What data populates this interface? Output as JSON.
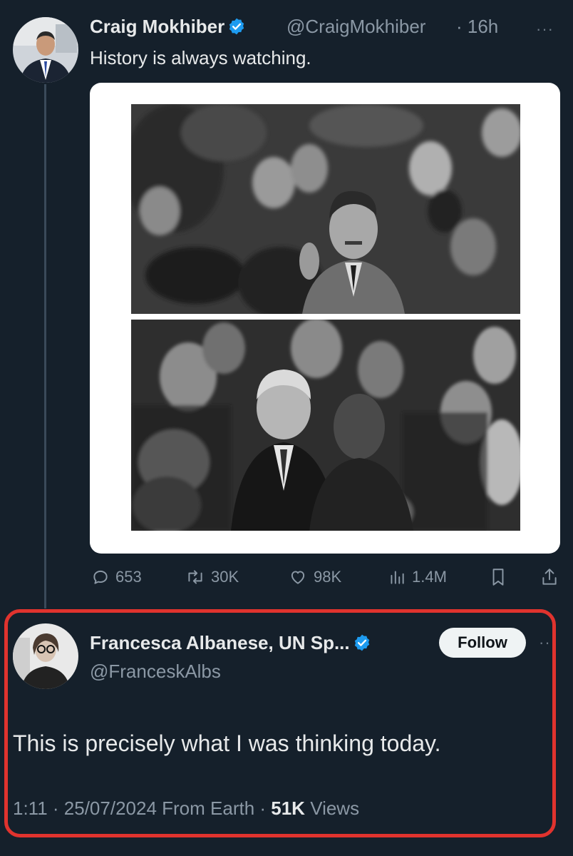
{
  "tweet1": {
    "name": "Craig Mokhiber",
    "handle": "@CraigMokhiber",
    "time": "· 16h",
    "text": "History is always watching.",
    "more": "···",
    "actions": {
      "replies": "653",
      "retweets": "30K",
      "likes": "98K",
      "views": "1.4M"
    }
  },
  "tweet2": {
    "name": "Francesca Albanese, UN Sp...",
    "handle": "@FranceskAlbs",
    "follow_label": "Follow",
    "more": "··",
    "text": "This is precisely what I was thinking today.",
    "meta_prefix": "1:11 · 25/07/2024 From Earth · ",
    "views_count": "51K",
    "views_label": " Views"
  },
  "colors": {
    "background": "#15202b",
    "verified": "#1d9bf0",
    "highlight": "#e0332e"
  }
}
